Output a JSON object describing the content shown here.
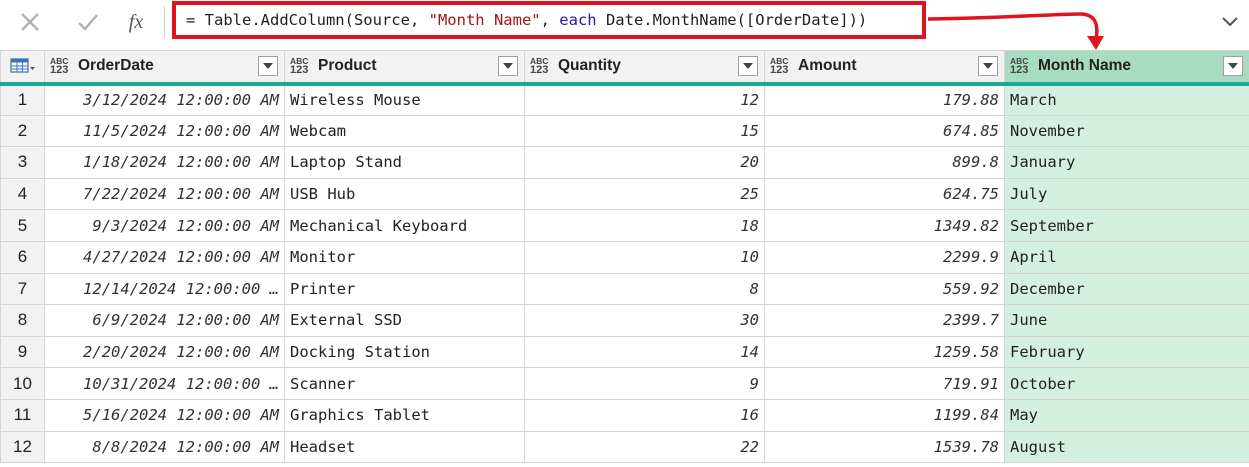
{
  "formula_bar": {
    "cancel_icon": "close-icon",
    "commit_icon": "checkmark-icon",
    "fx_label": "fx",
    "formula_prefix": "= Table.AddColumn(Source, ",
    "formula_string": "\"Month Name\"",
    "formula_mid": ", ",
    "formula_keyword": "each",
    "formula_suffix": " Date.MonthName([OrderDate]))",
    "expand_icon": "chevron-down-icon",
    "highlight_color": "#e0141c",
    "arrow_color": "#e0141c"
  },
  "table": {
    "corner_icon": "table-icon",
    "type_icon_top": "ABC",
    "type_icon_bottom": "123",
    "columns": [
      {
        "label": "OrderDate"
      },
      {
        "label": "Product"
      },
      {
        "label": "Quantity"
      },
      {
        "label": "Amount"
      },
      {
        "label": "Month Name"
      }
    ],
    "accent_color": "#1aa89a",
    "rows": [
      {
        "n": "1",
        "date": "3/12/2024 12:00:00 AM",
        "product": "Wireless Mouse",
        "qty": "12",
        "amount": "179.88",
        "month": "March"
      },
      {
        "n": "2",
        "date": "11/5/2024 12:00:00 AM",
        "product": "Webcam",
        "qty": "15",
        "amount": "674.85",
        "month": "November"
      },
      {
        "n": "3",
        "date": "1/18/2024 12:00:00 AM",
        "product": "Laptop Stand",
        "qty": "20",
        "amount": "899.8",
        "month": "January"
      },
      {
        "n": "4",
        "date": "7/22/2024 12:00:00 AM",
        "product": "USB Hub",
        "qty": "25",
        "amount": "624.75",
        "month": "July"
      },
      {
        "n": "5",
        "date": "9/3/2024 12:00:00 AM",
        "product": "Mechanical Keyboard",
        "qty": "18",
        "amount": "1349.82",
        "month": "September"
      },
      {
        "n": "6",
        "date": "4/27/2024 12:00:00 AM",
        "product": "Monitor",
        "qty": "10",
        "amount": "2299.9",
        "month": "April"
      },
      {
        "n": "7",
        "date": "12/14/2024 12:00:00 …",
        "product": "Printer",
        "qty": "8",
        "amount": "559.92",
        "month": "December"
      },
      {
        "n": "8",
        "date": "6/9/2024 12:00:00 AM",
        "product": "External SSD",
        "qty": "30",
        "amount": "2399.7",
        "month": "June"
      },
      {
        "n": "9",
        "date": "2/20/2024 12:00:00 AM",
        "product": "Docking Station",
        "qty": "14",
        "amount": "1259.58",
        "month": "February"
      },
      {
        "n": "10",
        "date": "10/31/2024 12:00:00 …",
        "product": "Scanner",
        "qty": "9",
        "amount": "719.91",
        "month": "October"
      },
      {
        "n": "11",
        "date": "5/16/2024 12:00:00 AM",
        "product": "Graphics Tablet",
        "qty": "16",
        "amount": "1199.84",
        "month": "May"
      },
      {
        "n": "12",
        "date": "8/8/2024 12:00:00 AM",
        "product": "Headset",
        "qty": "22",
        "amount": "1539.78",
        "month": "August"
      }
    ]
  }
}
